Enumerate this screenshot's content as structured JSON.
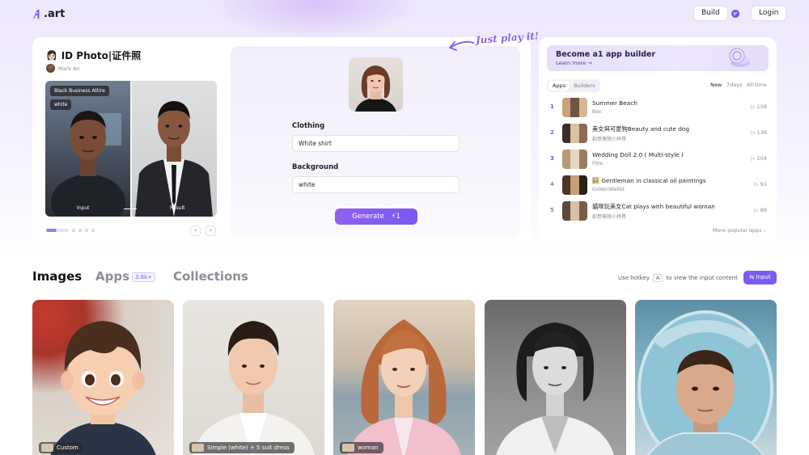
{
  "header": {
    "logo_text": ".art",
    "build_label": "Build",
    "chat_icon": "chat-bubble-icon",
    "login_label": "Login"
  },
  "hero": {
    "app_emoji": "👩🏻",
    "app_title": "ID Photo|证件照",
    "author": "Mark An",
    "preview": {
      "tag_attire": "Black Business Attire",
      "tag_color": "white",
      "input_caption": "Input",
      "result_caption": "Result"
    },
    "carousel": {
      "active_index": 0,
      "total": 5
    }
  },
  "form": {
    "clothing_label": "Clothing",
    "clothing_value": "White shirt",
    "background_label": "Background",
    "background_value": "white",
    "generate_label": "Generate",
    "generate_cost": "1",
    "just_play": "Just play it!"
  },
  "sidebar": {
    "banner_title": "Become a1 app builder",
    "banner_sub": "Learn more →",
    "tabs": [
      "Apps",
      "Builders"
    ],
    "active_tab": "Apps",
    "time_tabs": [
      "New",
      "7days",
      "All time"
    ],
    "active_time": "New",
    "ranking": [
      {
        "rank": "1",
        "name": "Summer Beach",
        "author": "Ben",
        "count": "158"
      },
      {
        "rank": "2",
        "name": "美女與可愛狗Beauty and cute dog",
        "author": "創意無限小林哥",
        "count": "136"
      },
      {
        "rank": "3",
        "name": "Wedding Doll 2.0 ( Multi-style )",
        "author": "Fitte",
        "count": "104"
      },
      {
        "rank": "4",
        "name": "🖼️ Gentleman in classical oil paintings",
        "author": "GoldenWallet",
        "count": "91"
      },
      {
        "rank": "5",
        "name": "貓咪玩美女Cat plays with beautiful woman",
        "author": "創意無限小林哥",
        "count": "89"
      }
    ],
    "more_label": "More popular apps"
  },
  "sections": {
    "images": "Images",
    "apps": "Apps",
    "apps_count": "3.6k+",
    "collections": "Collections",
    "hotkey_pre": "Use hotkey",
    "hotkey_key": "A",
    "hotkey_post": "to view the input content",
    "input_btn": "Input"
  },
  "gallery": [
    {
      "label": "Custom"
    },
    {
      "label": "Simple (white) + 5 suit dress"
    },
    {
      "label": "woman"
    },
    {
      "label": ""
    },
    {
      "label": ""
    }
  ],
  "colors": {
    "accent": "#7b5cf0",
    "accent_text": "#6f4fe4",
    "hero_bg": "#ede7fb"
  }
}
